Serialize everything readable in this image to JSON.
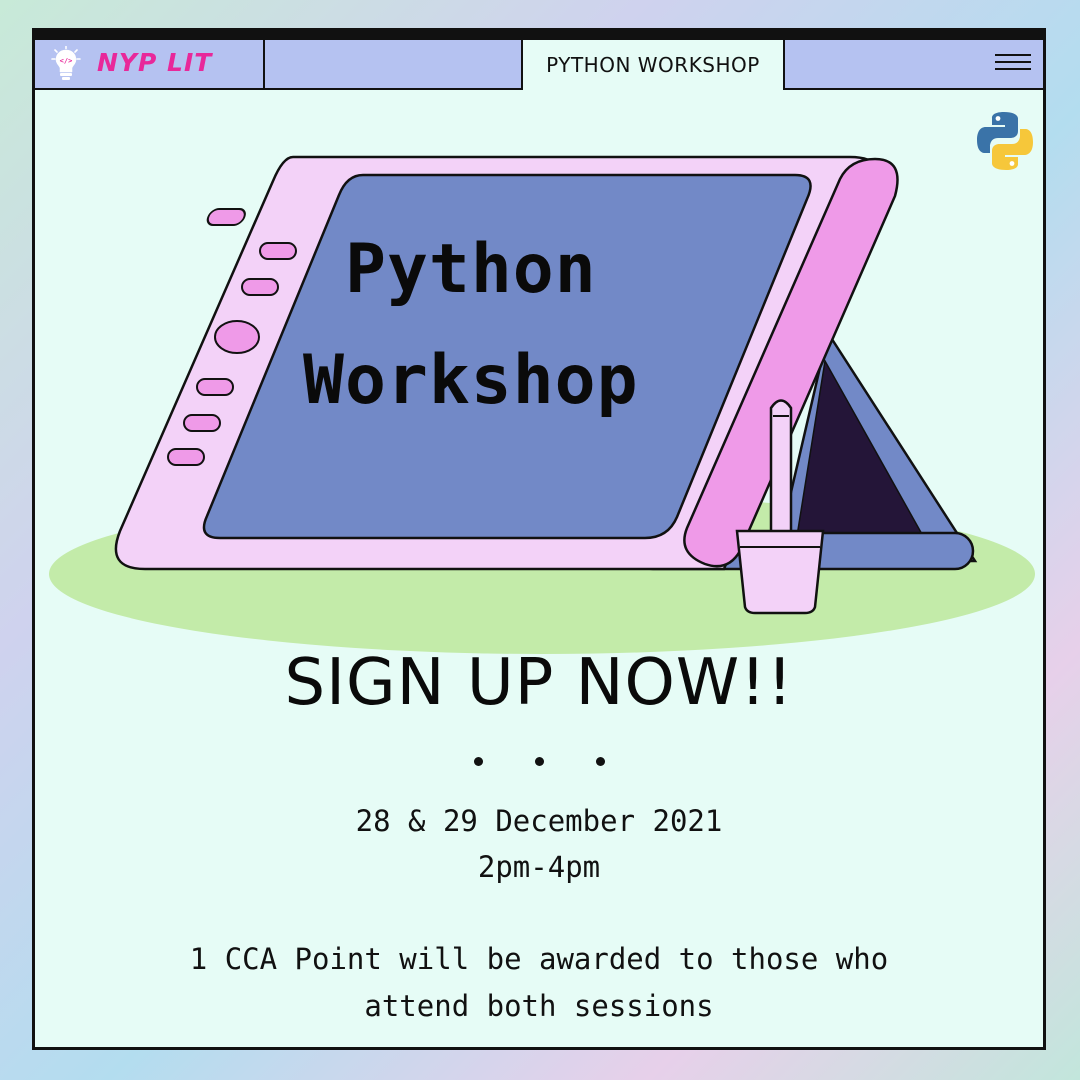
{
  "header": {
    "brand": "NYP LIT",
    "tab_label": "PYTHON WORKSHOP",
    "icons": [
      "lightbulb-code-icon",
      "hamburger-menu-icon",
      "python-logo-icon"
    ]
  },
  "hero": {
    "title_line1": "Python",
    "title_line2": "Workshop"
  },
  "cta": {
    "headline": "SIGN UP NOW!!",
    "date": "28 & 29 December 2021",
    "time": "2pm-4pm",
    "note_line1": "1 CCA Point will be awarded to those who",
    "note_line2": "attend both sessions"
  },
  "colors": {
    "accent_pink": "#e8289a",
    "toolbar": "#b5c2f1",
    "window_bg": "#e6fcf6",
    "tablet_frame": "#f3d2f8",
    "tablet_screen": "#7289c7",
    "ground": "#c3eba9"
  }
}
